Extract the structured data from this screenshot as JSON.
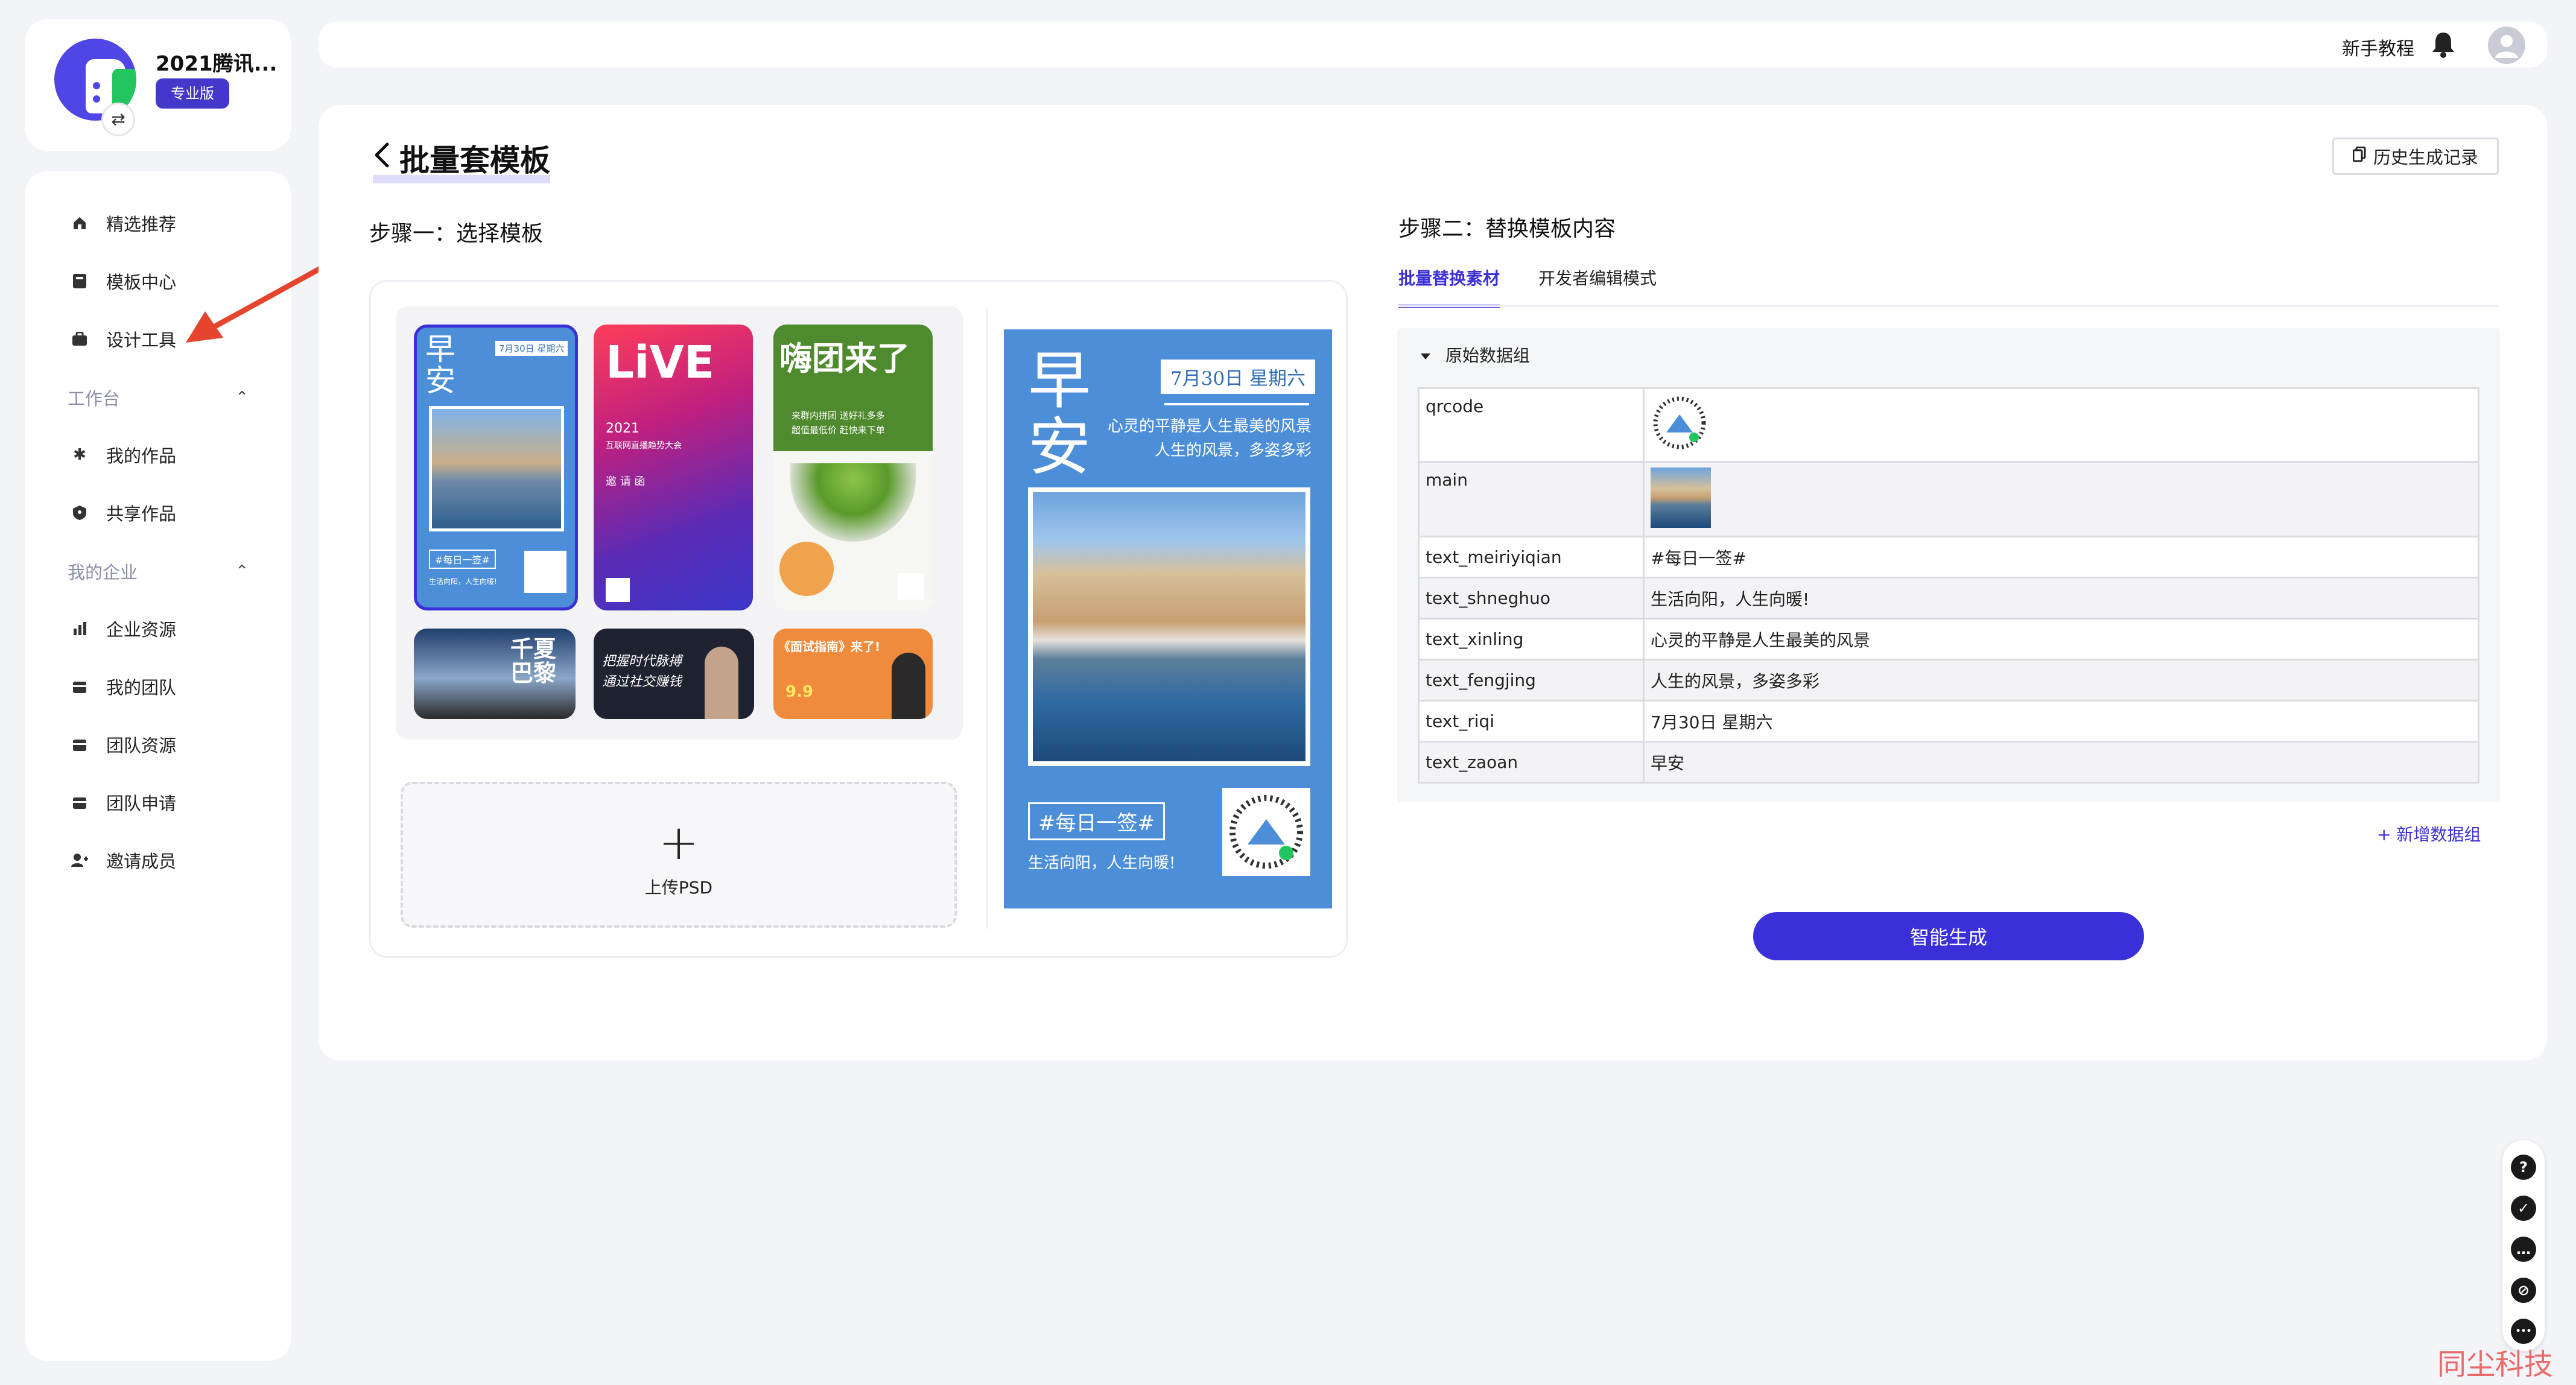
{
  "sidebar": {
    "brand_name": "2021腾讯...",
    "brand_tag": "专业版",
    "swap_icon": "⇄",
    "items_top": [
      {
        "label": "精选推荐",
        "icon": "home-icon"
      },
      {
        "label": "模板中心",
        "icon": "template-icon"
      },
      {
        "label": "设计工具",
        "icon": "briefcase-icon"
      }
    ],
    "group_workspace": "工作台",
    "items_workspace": [
      {
        "label": "我的作品",
        "icon": "gear-icon"
      },
      {
        "label": "共享作品",
        "icon": "shield-icon"
      }
    ],
    "group_enterprise": "我的企业",
    "items_enterprise": [
      {
        "label": "企业资源",
        "icon": "chart-icon"
      },
      {
        "label": "我的团队",
        "icon": "box-icon"
      },
      {
        "label": "团队资源",
        "icon": "box-icon"
      },
      {
        "label": "团队申请",
        "icon": "box-icon"
      },
      {
        "label": "邀请成员",
        "icon": "add-user-icon"
      }
    ]
  },
  "topbar": {
    "tutorial_label": "新手教程"
  },
  "page": {
    "title": "批量套模板",
    "history_label": "历史生成记录",
    "step1": "步骤一：选择模板",
    "step2": "步骤二：替换模板内容",
    "upload_label": "上传PSD",
    "upload_plus": "+"
  },
  "thumbnails": {
    "t1_big": "早安",
    "t1_date": "7月30日 星期六",
    "t1_tag": "#每日一签#",
    "t1_foot": "生活向阳，人生向暖!",
    "t2_title": "LiVE",
    "t2_year": "2021",
    "t2_sub": "互联网直播趋势大会",
    "t2_invite": "邀 请 函",
    "t3_title": "嗨团来了",
    "t3_sub": "来群内拼团 送好礼多多",
    "t3_sub2": "超值最低价 赶快来下单",
    "t4_title": "千夏巴黎",
    "t5_title": "把握时代脉搏",
    "t5_sub": "通过社交赚钱",
    "t6_title": "《面试指南》来了!",
    "t6_price": "9.9"
  },
  "preview": {
    "big_text": "早安",
    "date": "7月30日 星期六",
    "line1": "心灵的平静是人生最美的风景",
    "line2": "人生的风景，多姿多彩",
    "tag": "#每日一签#",
    "footer": "生活向阳，人生向暖!"
  },
  "tabs": [
    {
      "label": "批量替换素材",
      "active": true
    },
    {
      "label": "开发者编辑模式",
      "active": false
    }
  ],
  "data_group": {
    "title": "原始数据组",
    "rows": [
      {
        "key": "qrcode",
        "value": ""
      },
      {
        "key": "main",
        "value": ""
      },
      {
        "key": "text_meiriyiqian",
        "value": "#每日一签#"
      },
      {
        "key": "text_shneghuo",
        "value": "生活向阳，人生向暖!"
      },
      {
        "key": "text_xinling",
        "value": "心灵的平静是人生最美的风景"
      },
      {
        "key": "text_fengjing",
        "value": "人生的风景，多姿多彩"
      },
      {
        "key": "text_riqi",
        "value": "7月30日 星期六"
      },
      {
        "key": "text_zaoan",
        "value": "早安"
      }
    ],
    "add_label": "+ 新增数据组"
  },
  "generate_label": "智能生成",
  "float_tools": [
    "?",
    "✓",
    "…",
    "⊘",
    "•••"
  ],
  "watermark": "同尘科技",
  "colors": {
    "accent": "#3a2fd9",
    "preview_blue": "#4c8fd8",
    "arrow": "#e5452e"
  }
}
